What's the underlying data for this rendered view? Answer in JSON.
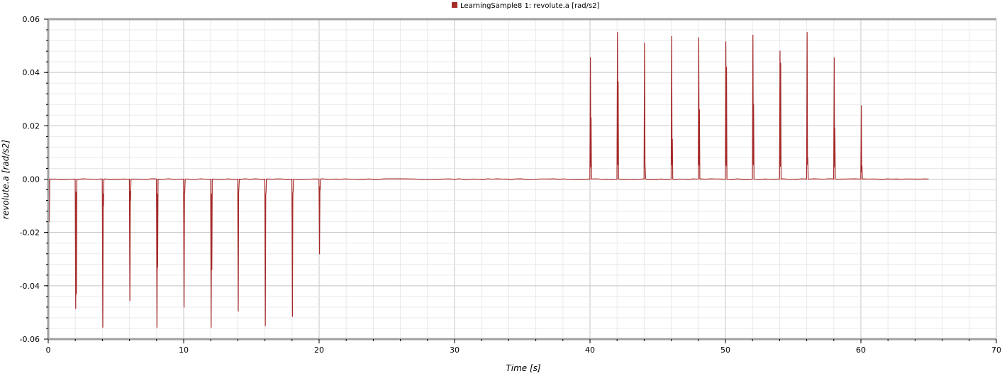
{
  "chart_data": {
    "type": "line",
    "title": "",
    "xlabel": "Time [s]",
    "ylabel": "revolute.a [rad/s2]",
    "xlim": [
      0,
      70
    ],
    "ylim": [
      -0.06,
      0.06
    ],
    "x_ticks": [
      0,
      10,
      20,
      30,
      40,
      50,
      60,
      70
    ],
    "y_ticks": [
      -0.06,
      -0.04,
      -0.02,
      0.0,
      0.02,
      0.04,
      0.06
    ],
    "x_tick_labels": [
      "0",
      "10",
      "20",
      "30",
      "40",
      "50",
      "60",
      "70"
    ],
    "y_tick_labels": [
      "-0.06",
      "-0.04",
      "-0.02",
      "0.00",
      "0.02",
      "0.04",
      "0.06"
    ],
    "grid": true,
    "legend_position": "top-center",
    "series": [
      {
        "name": "LearningSample8 1: revolute.a [rad/s2]",
        "color": "#a52a2a",
        "x_end": 65,
        "spikes": [
          {
            "t": 0.0,
            "peak": -0.0275,
            "echo": -0.016
          },
          {
            "t": 2.0,
            "peak": -0.0485,
            "echo": -0.043
          },
          {
            "t": 4.0,
            "peak": -0.0555,
            "echo": -0.01
          },
          {
            "t": 6.0,
            "peak": -0.0455,
            "echo": -0.008
          },
          {
            "t": 8.0,
            "peak": -0.0555,
            "echo": -0.033
          },
          {
            "t": 10.0,
            "peak": -0.048,
            "echo": -0.005
          },
          {
            "t": 12.0,
            "peak": -0.0555,
            "echo": -0.034
          },
          {
            "t": 14.0,
            "peak": -0.0495,
            "echo": -0.003
          },
          {
            "t": 16.0,
            "peak": -0.055,
            "echo": -0.005
          },
          {
            "t": 18.0,
            "peak": -0.0515,
            "echo": -0.005
          },
          {
            "t": 20.0,
            "peak": -0.028,
            "echo": -0.004
          },
          {
            "t": 40.0,
            "peak": 0.0455,
            "echo": 0.023
          },
          {
            "t": 42.0,
            "peak": 0.055,
            "echo": 0.0365
          },
          {
            "t": 44.0,
            "peak": 0.051,
            "echo": 0.004
          },
          {
            "t": 46.0,
            "peak": 0.0535,
            "echo": 0.015
          },
          {
            "t": 48.0,
            "peak": 0.053,
            "echo": 0.026
          },
          {
            "t": 50.0,
            "peak": 0.0515,
            "echo": 0.042
          },
          {
            "t": 52.0,
            "peak": 0.054,
            "echo": 0.028
          },
          {
            "t": 54.0,
            "peak": 0.048,
            "echo": 0.0435
          },
          {
            "t": 56.0,
            "peak": 0.055,
            "echo": 0.008
          },
          {
            "t": 58.0,
            "peak": 0.0455,
            "echo": 0.019
          },
          {
            "t": 60.0,
            "peak": 0.0275,
            "echo": 0.005
          }
        ]
      }
    ]
  }
}
